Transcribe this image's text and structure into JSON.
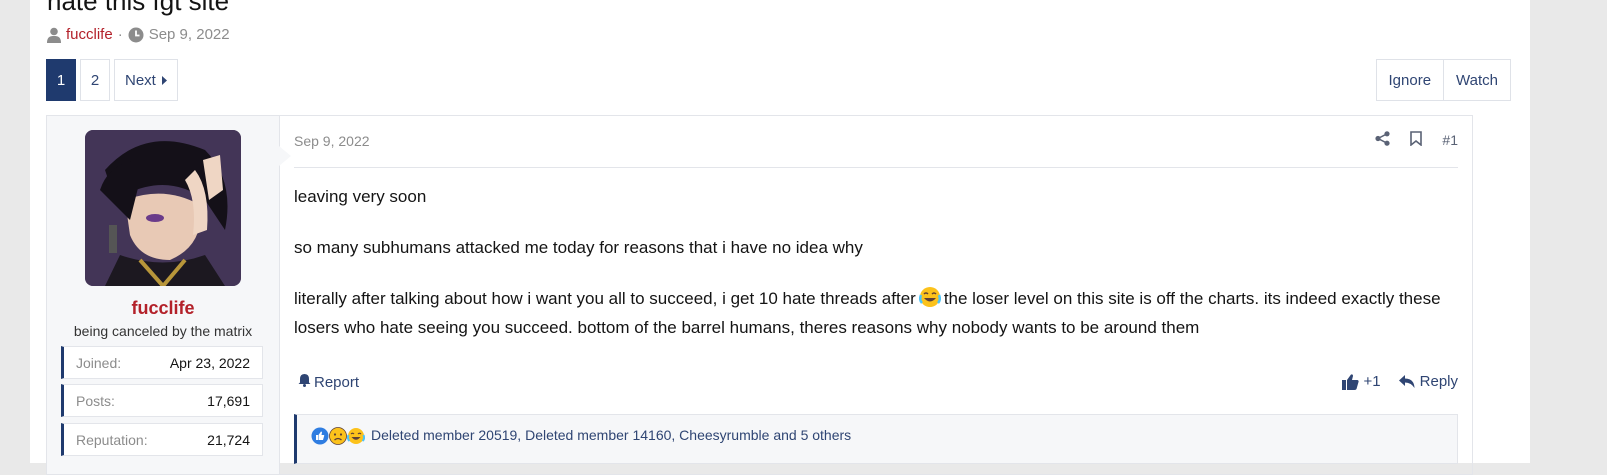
{
  "thread": {
    "title": "hate this fgt site",
    "author": "fucclife",
    "separator": "·",
    "date": "Sep 9, 2022"
  },
  "pagination": {
    "current": "1",
    "page2": "2",
    "next_label": "Next"
  },
  "thread_actions": {
    "ignore": "Ignore",
    "watch": "Watch"
  },
  "post": {
    "user": {
      "name": "fucclife",
      "title": "being canceled by the matrix",
      "stats": [
        {
          "label": "Joined:",
          "value": "Apr 23, 2022"
        },
        {
          "label": "Posts:",
          "value": "17,691"
        },
        {
          "label": "Reputation:",
          "value": "21,724"
        }
      ]
    },
    "date": "Sep 9, 2022",
    "number": "#1",
    "body": {
      "p1": "leaving very soon",
      "p2": "so many subhumans attacked me today for reasons that i have no idea why",
      "p3a": "literally after talking about how i want you all to succeed, i get 10 hate threads after",
      "p3b": "the loser level on this site is off the charts. its indeed exactly these losers who hate seeing you succeed. bottom of the barrel humans, theres reasons why nobody wants to be around them"
    },
    "footer": {
      "report": "Report",
      "like": "+1",
      "reply": "Reply"
    },
    "reactions_text": "Deleted member 20519, Deleted member 14160, Cheesyrumble and 5 others"
  },
  "colors": {
    "accent": "#1f3a6e",
    "username": "#b3212a",
    "link": "#2f4573"
  }
}
